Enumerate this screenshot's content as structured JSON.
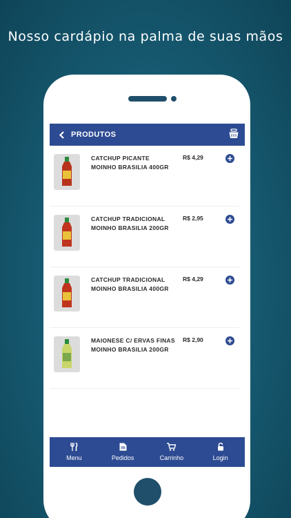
{
  "tagline": "Nosso cardápio na palma de suas mãos",
  "header": {
    "title": "PRODUTOS",
    "back_icon": "chevron-left-icon",
    "cart_icon": "basket-icon"
  },
  "products": [
    {
      "name": "CATCHUP PICANTE MOINHO BRASILIA 400GR",
      "price": "R$ 4,29",
      "bottle": "#b8331c"
    },
    {
      "name": "CATCHUP TRADICIONAL MOINHO BRASILIA 200GR",
      "price": "R$ 2,95",
      "bottle": "#c0341e"
    },
    {
      "name": "CATCHUP TRADICIONAL MOINHO BRASILIA 400GR",
      "price": "R$ 4,29",
      "bottle": "#c0341e"
    },
    {
      "name": "MAIONESE C/ ERVAS FINAS MOINHO BRASILIA 200GR",
      "price": "R$ 2,90",
      "bottle": "#c9d66a"
    }
  ],
  "nav": [
    {
      "label": "Menu",
      "icon": "fork-knife-icon"
    },
    {
      "label": "Pedidos",
      "icon": "document-icon"
    },
    {
      "label": "Carrinho",
      "icon": "cart-icon"
    },
    {
      "label": "Login",
      "icon": "lock-icon"
    }
  ],
  "colors": {
    "accent": "#2d4b92",
    "background": "#175d74"
  }
}
